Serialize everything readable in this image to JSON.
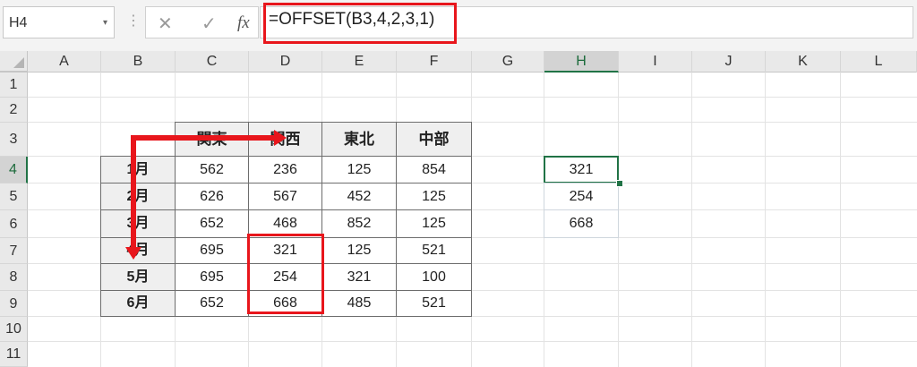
{
  "formula_bar": {
    "name_box": "H4",
    "name_box_dropdown": "▾",
    "separator": "⋮",
    "cancel_icon": "✕",
    "enter_icon": "✓",
    "fx_label": "fx",
    "formula": "=OFFSET(B3,4,2,3,1)"
  },
  "columns": [
    "A",
    "B",
    "C",
    "D",
    "E",
    "F",
    "G",
    "H",
    "I",
    "J",
    "K",
    "L"
  ],
  "selected_column": "H",
  "rows": [
    "1",
    "2",
    "3",
    "4",
    "5",
    "6",
    "7",
    "8",
    "9",
    "10",
    "11"
  ],
  "selected_row": "4",
  "table": {
    "headers": [
      "関東",
      "関西",
      "東北",
      "中部"
    ],
    "row_labels": [
      "1月",
      "2月",
      "3月",
      "4月",
      "5月",
      "6月"
    ],
    "values": [
      [
        "562",
        "236",
        "125",
        "854"
      ],
      [
        "626",
        "567",
        "452",
        "125"
      ],
      [
        "652",
        "468",
        "852",
        "125"
      ],
      [
        "695",
        "321",
        "125",
        "521"
      ],
      [
        "695",
        "254",
        "321",
        "100"
      ],
      [
        "652",
        "668",
        "485",
        "521"
      ]
    ]
  },
  "result_column": [
    "321",
    "254",
    "668"
  ],
  "annotation_colors": {
    "highlight": "#e8161c",
    "selection": "#217346"
  }
}
